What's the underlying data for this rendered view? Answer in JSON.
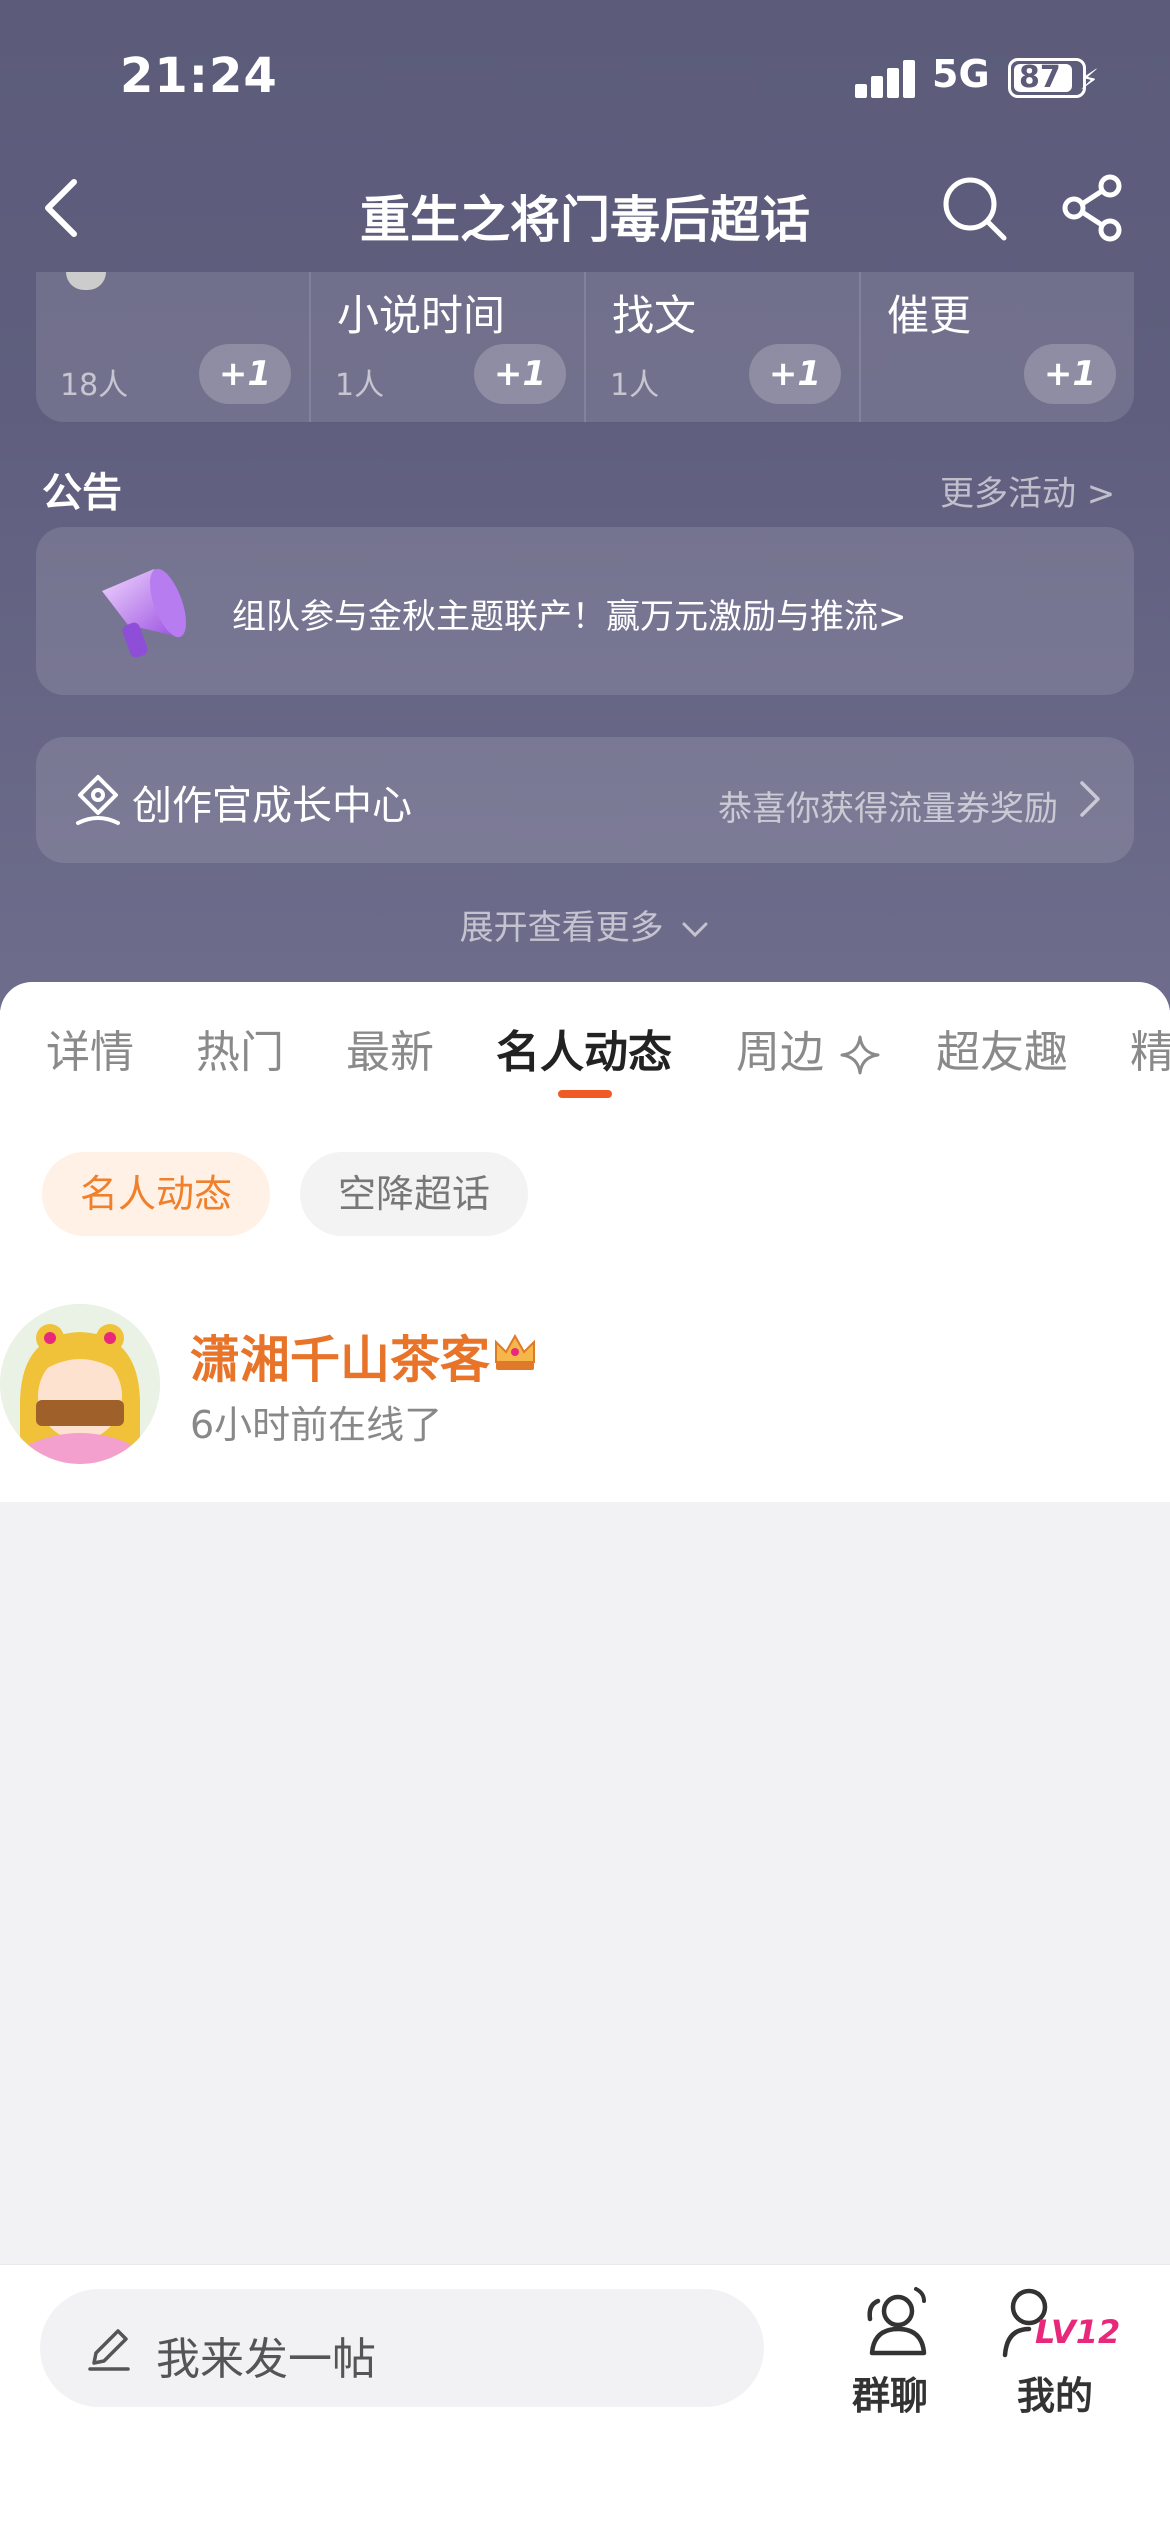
{
  "status_bar": {
    "time": "21:24",
    "network": "5G",
    "battery": "87"
  },
  "nav": {
    "title": "重生之将门毒后超话"
  },
  "categories": [
    {
      "name": "",
      "count": "18人",
      "plus": "+1"
    },
    {
      "name": "小说时间",
      "count": "1人",
      "plus": "+1"
    },
    {
      "name": "找文",
      "count": "1人",
      "plus": "+1"
    },
    {
      "name": "催更",
      "count": "",
      "plus": "+1"
    }
  ],
  "announcement": {
    "title": "公告",
    "more": "更多活动 >",
    "text": "组队参与金秋主题联产！赢万元激励与推流>"
  },
  "creator": {
    "title": "创作官成长中心",
    "reward": "恭喜你获得流量券奖励"
  },
  "expand": "展开查看更多",
  "tabs": [
    {
      "label": "详情"
    },
    {
      "label": "热门"
    },
    {
      "label": "最新"
    },
    {
      "label": "名人动态"
    },
    {
      "label": "周边"
    },
    {
      "label": "超友趣"
    },
    {
      "label": "精"
    }
  ],
  "filters": {
    "active": "名人动态",
    "other": "空降超话"
  },
  "user": {
    "name": "潇湘千山茶客",
    "status": "6小时前在线了"
  },
  "bottom": {
    "post_placeholder": "我来发一帖",
    "group_chat": "群聊",
    "mine": "我的",
    "level": "LV12"
  },
  "colors": {
    "accent": "#ef5a26",
    "name_orange": "#e8742a",
    "hero_bg": "#5c5b7a",
    "level_pink": "#e8287a"
  }
}
